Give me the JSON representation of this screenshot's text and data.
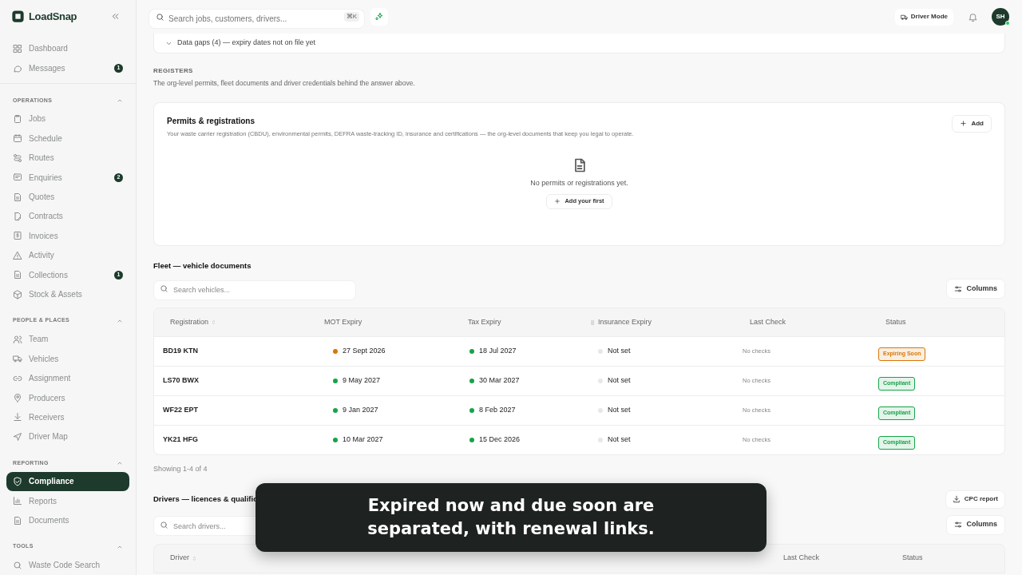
{
  "brand": "LoadSnap",
  "sidebar": {
    "top_items": [
      {
        "label": "Dashboard",
        "selected": false
      },
      {
        "label": "Messages",
        "badge": "1",
        "selected": false
      }
    ],
    "sections": [
      {
        "title": "OPERATIONS",
        "expanded": true,
        "items": [
          {
            "label": "Jobs",
            "selected": false
          },
          {
            "label": "Schedule",
            "selected": false
          },
          {
            "label": "Routes",
            "selected": false
          },
          {
            "label": "Enquiries",
            "badge": "2",
            "selected": false
          },
          {
            "label": "Quotes",
            "selected": false
          },
          {
            "label": "Contracts",
            "selected": false
          },
          {
            "label": "Invoices",
            "selected": false
          },
          {
            "label": "Activity",
            "selected": false
          },
          {
            "label": "Collections",
            "badge": "1",
            "selected": false
          },
          {
            "label": "Stock & Assets",
            "selected": false
          }
        ]
      },
      {
        "title": "PEOPLE & PLACES",
        "expanded": true,
        "items": [
          {
            "label": "Team",
            "selected": false
          },
          {
            "label": "Vehicles",
            "selected": false
          },
          {
            "label": "Assignment",
            "selected": false
          },
          {
            "label": "Producers",
            "selected": false
          },
          {
            "label": "Receivers",
            "selected": false
          },
          {
            "label": "Driver Map",
            "selected": false
          }
        ]
      },
      {
        "title": "REPORTING",
        "expanded": true,
        "items": [
          {
            "label": "Compliance",
            "selected": true
          },
          {
            "label": "Reports",
            "selected": false
          },
          {
            "label": "Documents",
            "selected": false
          }
        ]
      },
      {
        "title": "TOOLS",
        "expanded": true,
        "items": [
          {
            "label": "Waste Code Search",
            "selected": false
          }
        ]
      }
    ]
  },
  "topbar": {
    "search": {
      "placeholder": "Search jobs, customers, drivers...",
      "shortcut": "⌘K"
    },
    "driver_mode": "Driver Mode",
    "avatar": "SH"
  },
  "data_gaps": {
    "label": "Data gaps (4) — expiry dates not on file yet",
    "expanded": false
  },
  "registers": {
    "heading": "REGISTERS",
    "description": "The org-level permits, fleet documents and driver credentials behind the answer above."
  },
  "permits": {
    "title": "Permits & registrations",
    "description": "Your waste carrier registration (CBDU), environmental permits, DEFRA waste-tracking ID, insurance and certifications — the org-level documents that keep you legal to operate.",
    "add_button": "Add",
    "empty_text": "No permits or registrations yet.",
    "empty_button": "Add your first"
  },
  "fleet": {
    "title": "Fleet — vehicle documents",
    "search": {
      "placeholder": "Search vehicles..."
    },
    "columns_button": "Columns",
    "table": {
      "columns": [
        "Registration",
        "MOT Expiry",
        "Tax Expiry",
        "Insurance Expiry",
        "Last Check",
        "Status"
      ],
      "rows": [
        {
          "registration": "BD19 KTN",
          "mot": {
            "text": "27 Sept 2026",
            "color": "#d97706"
          },
          "tax": {
            "text": "18 Jul 2027",
            "color": "#16a34a"
          },
          "insurance": {
            "text": "Not set",
            "color": "#e5e7eb"
          },
          "last_check": "No checks",
          "status": {
            "text": "Expiring Soon",
            "color": "#d97706"
          }
        },
        {
          "registration": "LS70 BWX",
          "mot": {
            "text": "9 May 2027",
            "color": "#16a34a"
          },
          "tax": {
            "text": "30 Mar 2027",
            "color": "#16a34a"
          },
          "insurance": {
            "text": "Not set",
            "color": "#e5e7eb"
          },
          "last_check": "No checks",
          "status": {
            "text": "Compliant",
            "color": "#16a34a"
          }
        },
        {
          "registration": "WF22 EPT",
          "mot": {
            "text": "9 Jan 2027",
            "color": "#16a34a"
          },
          "tax": {
            "text": "8 Feb 2027",
            "color": "#16a34a"
          },
          "insurance": {
            "text": "Not set",
            "color": "#e5e7eb"
          },
          "last_check": "No checks",
          "status": {
            "text": "Compliant",
            "color": "#16a34a"
          }
        },
        {
          "registration": "YK21 HFG",
          "mot": {
            "text": "10 Mar 2027",
            "color": "#16a34a"
          },
          "tax": {
            "text": "15 Dec 2026",
            "color": "#16a34a"
          },
          "insurance": {
            "text": "Not set",
            "color": "#e5e7eb"
          },
          "last_check": "No checks",
          "status": {
            "text": "Compliant",
            "color": "#16a34a"
          }
        }
      ]
    },
    "footer": "Showing 1-4 of 4"
  },
  "drivers": {
    "title": "Drivers — licences & qualific",
    "report_button": "CPC report",
    "search": {
      "placeholder": "Search drivers..."
    },
    "columns_button": "Columns",
    "table": {
      "columns": [
        "Driver",
        "Last Check",
        "Status"
      ]
    }
  },
  "caption": "Expired now and due soon are separated, with renewal links."
}
